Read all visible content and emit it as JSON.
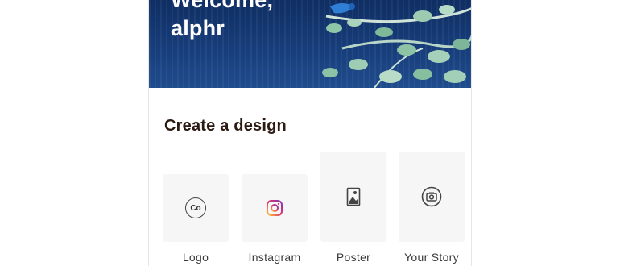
{
  "header": {
    "greeting": "Welcome,\nalphr"
  },
  "section": {
    "title": "Create a design"
  },
  "design_types": [
    {
      "label": "Logo",
      "icon": "logo-co-icon",
      "icon_text": "Co"
    },
    {
      "label": "Instagram",
      "icon": "instagram-icon"
    },
    {
      "label": "Poster",
      "icon": "poster-image-icon"
    },
    {
      "label": "Your Story",
      "icon": "camera-icon"
    }
  ],
  "colors": {
    "hero_background": "#173d7a",
    "title_text": "#2b1a12",
    "tile_background": "#f6f6f6",
    "instagram_gradient": [
      "#fdc830",
      "#e1306c",
      "#833ab4"
    ]
  }
}
